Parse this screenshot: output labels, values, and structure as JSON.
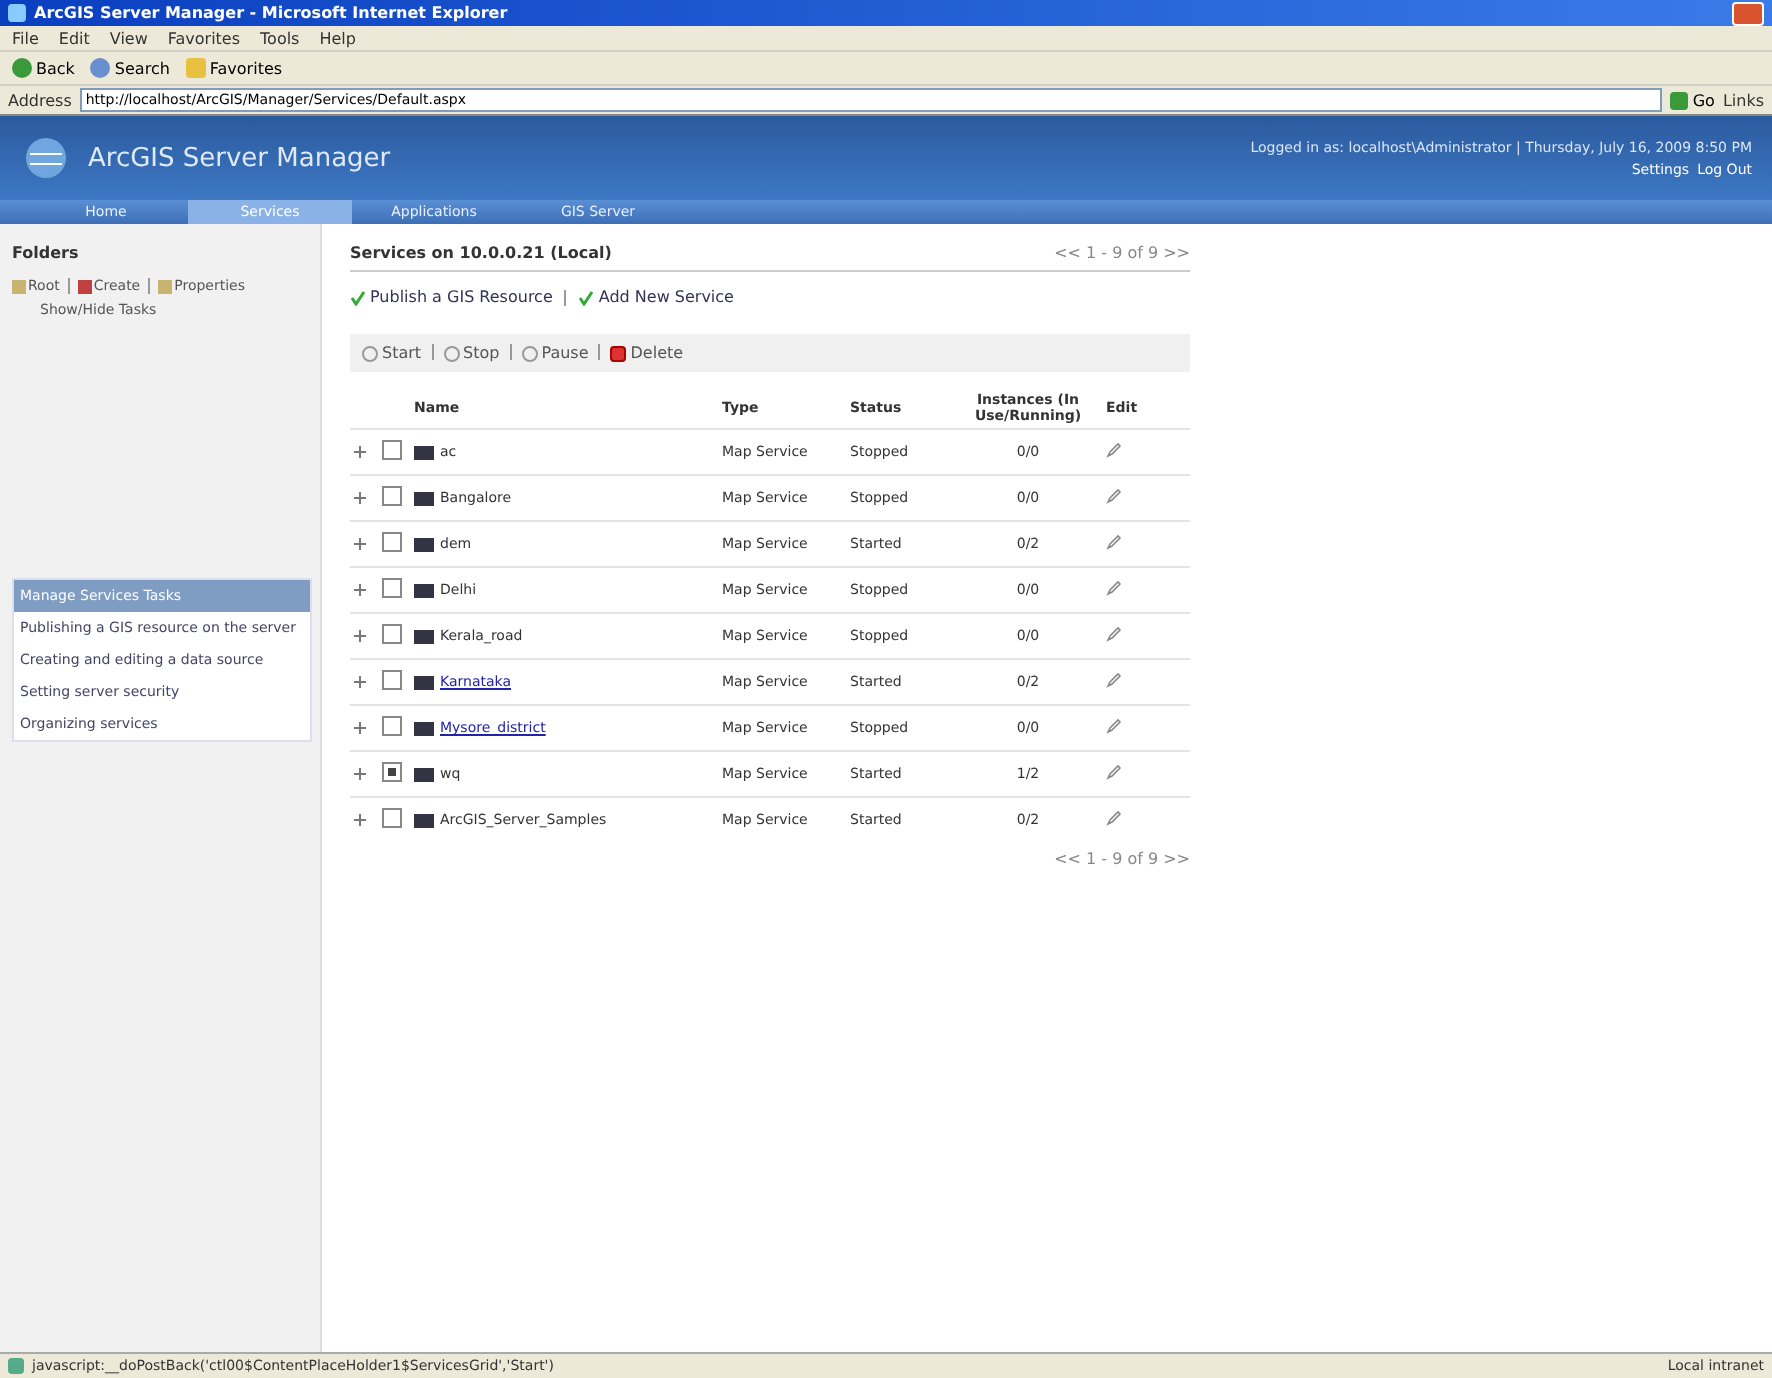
{
  "window": {
    "title": "ArcGIS Server Manager - Microsoft Internet Explorer"
  },
  "menu": [
    "File",
    "Edit",
    "View",
    "Favorites",
    "Tools",
    "Help"
  ],
  "toolbar": [
    "Back",
    "Search",
    "Favorites"
  ],
  "address": {
    "label": "Address",
    "value": "http://localhost/ArcGIS/Manager/Services/Default.aspx",
    "go": "Go",
    "links": "Links"
  },
  "header": {
    "title": "ArcGIS Server Manager",
    "login": "Logged in as: localhost\\Administrator | Thursday, July 16, 2009 8:50 PM",
    "links": [
      "Settings",
      "Log Out"
    ]
  },
  "tabs": [
    {
      "label": "Home",
      "selected": false
    },
    {
      "label": "Services",
      "selected": true
    },
    {
      "label": "Applications",
      "selected": false
    },
    {
      "label": "GIS Server",
      "selected": false
    }
  ],
  "folders": {
    "title": "Folders",
    "actions": [
      "Root",
      "Create",
      "Properties"
    ],
    "toggle": "Show/Hide Tasks"
  },
  "tasks": {
    "title": "Manage Services Tasks",
    "items": [
      "Publishing a GIS resource on the server",
      "Creating and editing a data source",
      "Setting server security",
      "Organizing services"
    ]
  },
  "services": {
    "heading": "Services on 10.0.0.21 (Local)",
    "pager": "<< 1 - 9 of 9 >>",
    "links": [
      "Publish a GIS Resource",
      "Add New Service"
    ],
    "actions": [
      {
        "label": "Start",
        "kind": "start"
      },
      {
        "label": "Stop",
        "kind": "stop"
      },
      {
        "label": "Pause",
        "kind": "pause"
      },
      {
        "label": "Delete",
        "kind": "delete"
      }
    ],
    "columns": [
      "Name",
      "Type",
      "Status",
      "Instances (In Use/Running)",
      "Edit"
    ],
    "rows": [
      {
        "name": "ac",
        "type": "Map Service",
        "status": "Stopped",
        "instances": "0/0",
        "checked": false,
        "link": false
      },
      {
        "name": "Bangalore",
        "type": "Map Service",
        "status": "Stopped",
        "instances": "0/0",
        "checked": false,
        "link": false
      },
      {
        "name": "dem",
        "type": "Map Service",
        "status": "Started",
        "instances": "0/2",
        "checked": false,
        "link": false
      },
      {
        "name": "Delhi",
        "type": "Map Service",
        "status": "Stopped",
        "instances": "0/0",
        "checked": false,
        "link": false
      },
      {
        "name": "Kerala_road",
        "type": "Map Service",
        "status": "Stopped",
        "instances": "0/0",
        "checked": false,
        "link": false
      },
      {
        "name": "Karnataka",
        "type": "Map Service",
        "status": "Started",
        "instances": "0/2",
        "checked": false,
        "link": true
      },
      {
        "name": "Mysore_district",
        "type": "Map Service",
        "status": "Stopped",
        "instances": "0/0",
        "checked": false,
        "link": true
      },
      {
        "name": "wq",
        "type": "Map Service",
        "status": "Started",
        "instances": "1/2",
        "checked": true,
        "link": false
      },
      {
        "name": "ArcGIS_Server_Samples",
        "type": "Map Service",
        "status": "Started",
        "instances": "0/2",
        "checked": false,
        "link": false
      }
    ],
    "pager_bottom": "<< 1 - 9 of 9 >>"
  },
  "status_bar": {
    "text": "javascript:__doPostBack('ctl00$ContentPlaceHolder1$ServicesGrid','Start')",
    "zone": "Local intranet"
  }
}
